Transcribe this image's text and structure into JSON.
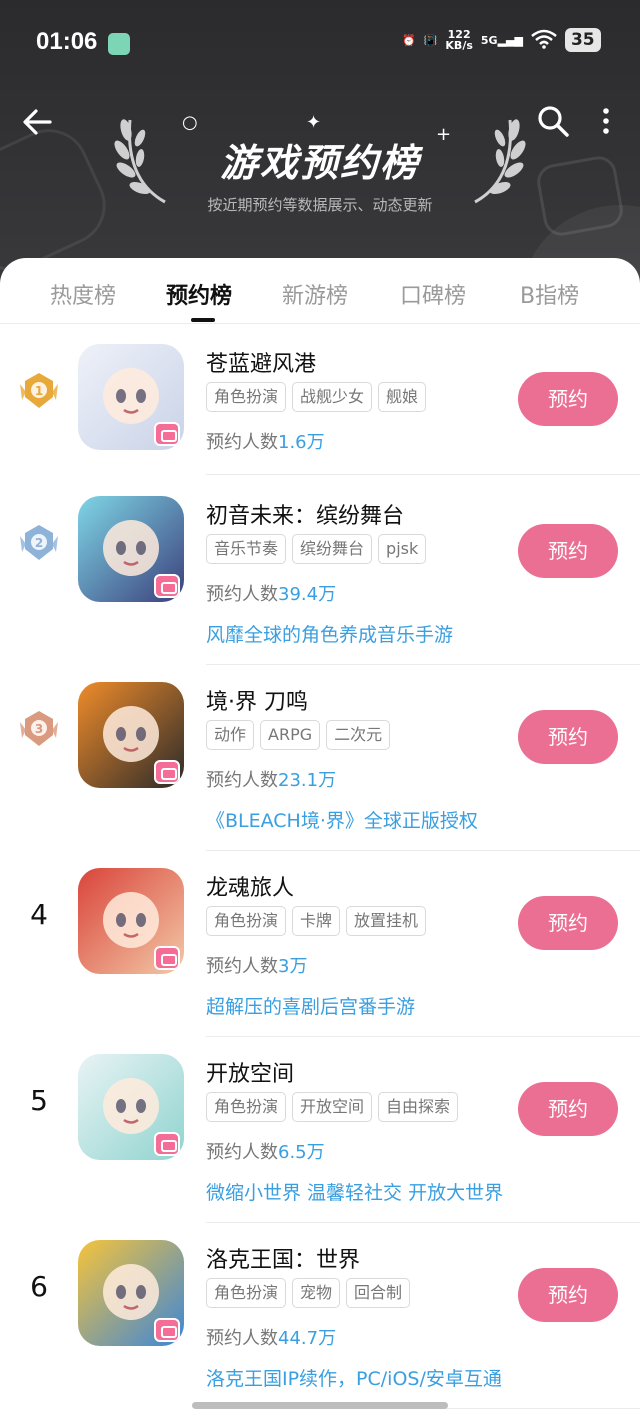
{
  "status_bar": {
    "time": "01:06",
    "net_speed_value": "122",
    "net_speed_unit": "KB/s",
    "network": "5G",
    "battery": "35"
  },
  "header": {
    "title": "游戏预约榜",
    "subtitle": "按近期预约等数据展示、动态更新"
  },
  "tabs": [
    {
      "label": "热度榜",
      "active": false
    },
    {
      "label": "预约榜",
      "active": true
    },
    {
      "label": "新游榜",
      "active": false
    },
    {
      "label": "口碑榜",
      "active": false
    },
    {
      "label": "B指榜",
      "active": false
    }
  ],
  "count_label": "预约人数",
  "button_label": "预约",
  "games": [
    {
      "rank": "1",
      "name": "苍蓝避风港",
      "tags": [
        "角色扮演",
        "战舰少女",
        "舰娘"
      ],
      "count": "1.6万",
      "desc": "",
      "medal_color": "#e8a93a",
      "icon_colors": [
        "#eef1f8",
        "#c9d3e8"
      ]
    },
    {
      "rank": "2",
      "name": "初音未来：缤纷舞台",
      "tags": [
        "音乐节奏",
        "缤纷舞台",
        "pjsk"
      ],
      "count": "39.4万",
      "desc": "风靡全球的角色养成音乐手游",
      "medal_color": "#8fb2d9",
      "icon_colors": [
        "#7fd6e6",
        "#3b3f7c"
      ]
    },
    {
      "rank": "3",
      "name": "境·界 刀鸣",
      "tags": [
        "动作",
        "ARPG",
        "二次元"
      ],
      "count": "23.1万",
      "desc": "《BLEACH境·界》全球正版授权",
      "medal_color": "#d99a7f",
      "icon_colors": [
        "#f08c2a",
        "#2a2a2a"
      ]
    },
    {
      "rank": "4",
      "name": "龙魂旅人",
      "tags": [
        "角色扮演",
        "卡牌",
        "放置挂机"
      ],
      "count": "3万",
      "desc": "超解压的喜剧后宫番手游",
      "medal_color": "",
      "icon_colors": [
        "#d9443a",
        "#f3c9a8"
      ]
    },
    {
      "rank": "5",
      "name": "开放空间",
      "tags": [
        "角色扮演",
        "开放空间",
        "自由探索"
      ],
      "count": "6.5万",
      "desc": "微缩小世界 温馨轻社交 开放大世界",
      "medal_color": "",
      "icon_colors": [
        "#e9f3f5",
        "#8fd4cf"
      ]
    },
    {
      "rank": "6",
      "name": "洛克王国：世界",
      "tags": [
        "角色扮演",
        "宠物",
        "回合制"
      ],
      "count": "44.7万",
      "desc": "洛克王国IP续作，PC/iOS/安卓互通",
      "medal_color": "",
      "icon_colors": [
        "#f6c43a",
        "#3c86d8"
      ]
    }
  ]
}
